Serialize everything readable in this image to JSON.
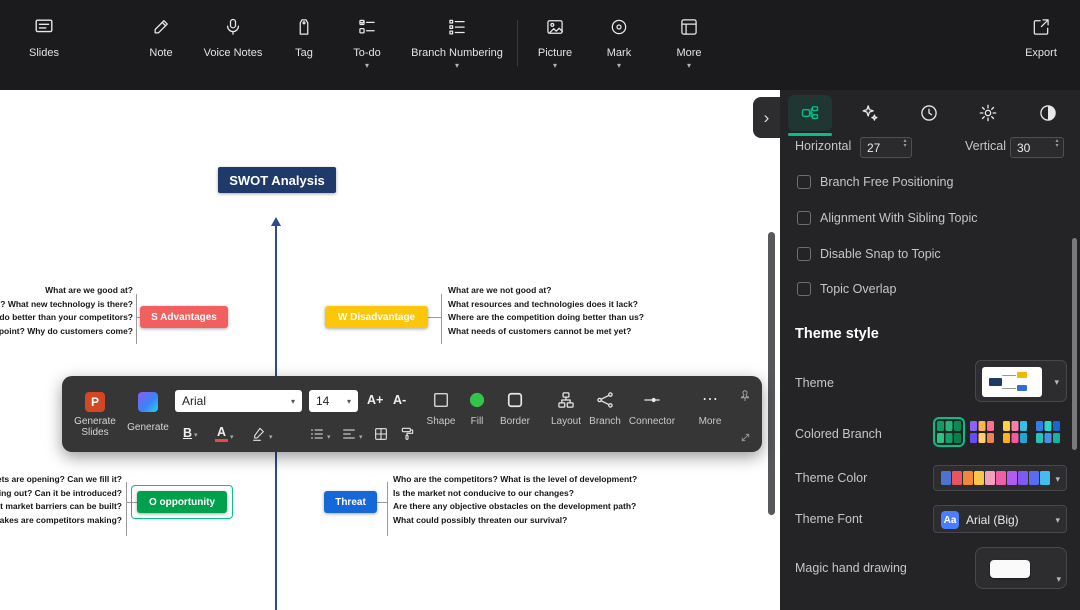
{
  "icons": {
    "caret_down": "▾",
    "caret_up": "▴",
    "chevron_right": "›",
    "ellipsis": "⋯"
  },
  "topbar": {
    "items": [
      {
        "label": "Slides"
      },
      {
        "label": "Note"
      },
      {
        "label": "Voice Notes"
      },
      {
        "label": "Tag"
      },
      {
        "label": "To-do"
      },
      {
        "label": "Branch Numbering"
      },
      {
        "label": "Picture"
      },
      {
        "label": "Mark"
      },
      {
        "label": "More"
      }
    ],
    "export_label": "Export"
  },
  "floating_toolbar": {
    "generate_slides_label": "Generate Slides",
    "generate_label": "Generate",
    "font_family": "Arial",
    "font_size": "14",
    "increase_font_label": "A+",
    "decrease_font_label": "A-",
    "bold_label": "B",
    "font_color_label": "A",
    "buttons": {
      "shape": "Shape",
      "fill": "Fill",
      "border": "Border",
      "layout": "Layout",
      "branch": "Branch",
      "connector": "Connector",
      "more": "More"
    }
  },
  "canvas": {
    "root_label": "SWOT Analysis",
    "nodes": {
      "advantages": {
        "label": "S Advantages",
        "color": "#f25f5f"
      },
      "disadvantage": {
        "label": "W Disadvantage",
        "color": "#fcc60b"
      },
      "opportunity": {
        "label": "O opportunity",
        "color": "#00a14d"
      },
      "threat": {
        "label": "Threat",
        "color": "#1668d9"
      }
    },
    "notes_top_left": [
      "What are we good at?",
      "e? What new technology is there?",
      "n do better than your competitors?",
      "g point? Why do customers come?"
    ],
    "notes_top_right": [
      "What are we not good at?",
      "What resources and technologies does it lack?",
      "Where are the competition doing better than us?",
      "What needs of customers cannot be met yet?"
    ],
    "notes_bottom_left": [
      "arkets are opening? Can we fill it?",
      "oming out? Can it be introduced?",
      "hat market barriers can be built?",
      "istakes are competitors making?"
    ],
    "notes_bottom_right": [
      "Who are the competitors? What is the level of development?",
      "Is the market not conducive to our changes?",
      "Are there any objective obstacles on the development path?",
      "What could possibly threaten our survival?"
    ]
  },
  "panel": {
    "spacing": {
      "horizontal_label": "Horizontal",
      "horizontal_value": "27",
      "vertical_label": "Vertical",
      "vertical_value": "30"
    },
    "checkboxes": [
      {
        "label": "Branch Free Positioning",
        "checked": false
      },
      {
        "label": "Alignment With Sibling Topic",
        "checked": false
      },
      {
        "label": "Disable Snap to Topic",
        "checked": false
      },
      {
        "label": "Topic Overlap",
        "checked": false
      }
    ],
    "theme_style_heading": "Theme style",
    "theme_label": "Theme",
    "colored_branch_label": "Colored Branch",
    "theme_color_label": "Theme Color",
    "theme_color_chips": [
      "background:#4a74d0",
      "background:#e8555f",
      "background:#f2873c",
      "background:#f7c64a",
      "background:#f2a0c0",
      "background:#ee5fa7",
      "background:#b55bf5",
      "background:#7e5bf0",
      "background:#5a6cf0",
      "background:#45bdeb"
    ],
    "theme_font_label": "Theme Font",
    "theme_font_badge": "Aa",
    "theme_font_value": "Arial (Big)",
    "magic_label": "Magic hand drawing"
  },
  "colors": {
    "accent_green": "#00c08b",
    "selection": "#00c781",
    "root_node": "#1f3968",
    "arrow_line": "#2e4b8f"
  }
}
